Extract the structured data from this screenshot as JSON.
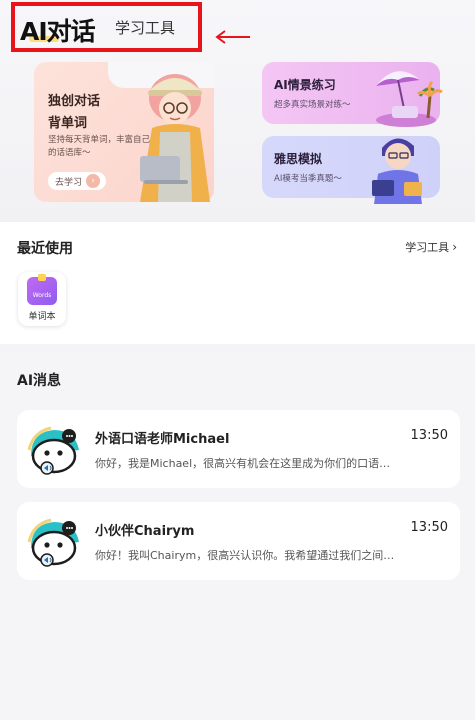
{
  "header": {
    "tab_ai": "AI对话",
    "tab_tools": "学习工具"
  },
  "feature_cards": {
    "main": {
      "title_line1": "独创对话",
      "title_line2": "背单词",
      "desc": "坚持每天背单词，丰富自己的话语库～",
      "button": "去学习"
    },
    "scene": {
      "title": "AI情景练习",
      "desc": "超多真实场景对练～"
    },
    "ielts": {
      "title": "雅思模拟",
      "desc": "AI模考当季真题～"
    }
  },
  "recent": {
    "title": "最近使用",
    "more_label": "学习工具",
    "apps": [
      {
        "label": "单词本",
        "icon": "wordbook-icon",
        "icon_text": "Words"
      }
    ]
  },
  "ai_messages": {
    "title": "AI消息",
    "items": [
      {
        "name": "外语口语老师Michael",
        "time": "13:50",
        "preview": "你好，我是Michael，很高兴有机会在这里成为你们的口语…"
      },
      {
        "name": "小伙伴Chairym",
        "time": "13:50",
        "preview": "你好！我叫Chairym，很高兴认识你。我希望通过我们之间…"
      }
    ]
  },
  "colors": {
    "highlight_box": "#e8141c",
    "main_card": "#fbd4cb",
    "scene_card": "#eab2ef",
    "ielts_card": "#d2d4fa",
    "avatar_teal": "#2bbfc6"
  }
}
